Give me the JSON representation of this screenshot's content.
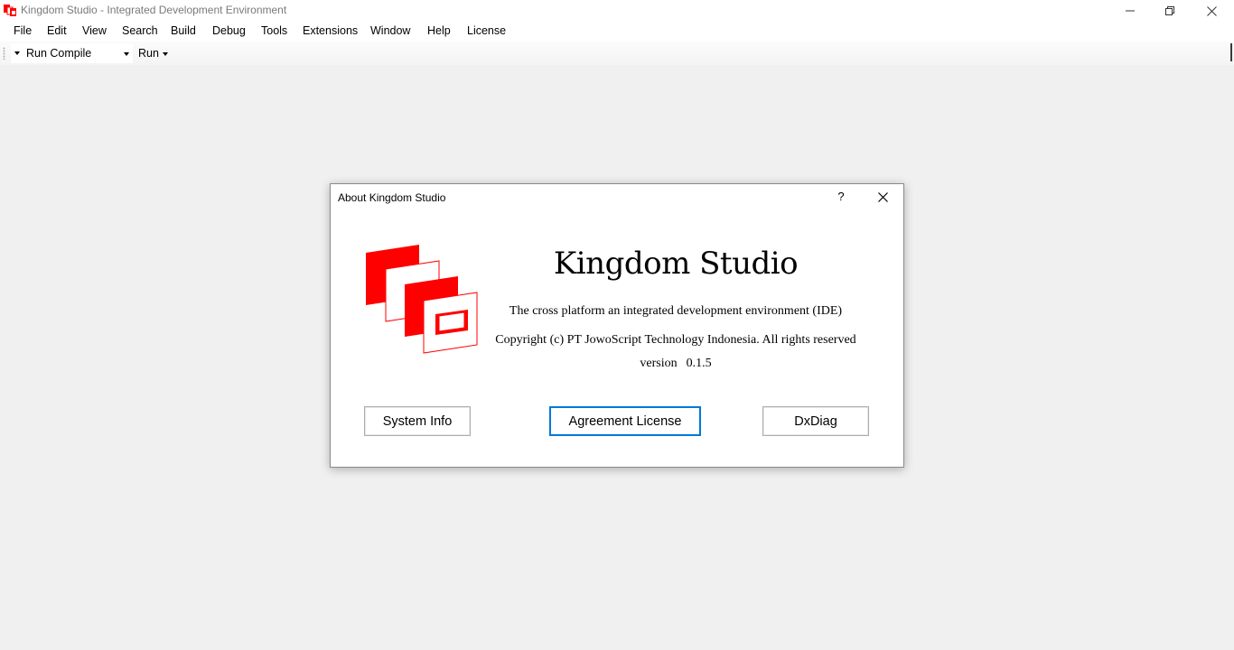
{
  "window": {
    "title": "Kingdom Studio - Integrated Development Environment",
    "icon": "kingdom-studio-logo-icon"
  },
  "menubar": {
    "items": [
      "File",
      "Edit",
      "View",
      "Search",
      "Build",
      "Debug",
      "Tools",
      "Extensions",
      "Window",
      "Help",
      "License"
    ]
  },
  "toolbar": {
    "build_config": "Run Compile",
    "run_label": "Run"
  },
  "about_dialog": {
    "title": "About Kingdom Studio",
    "help_label": "?",
    "product_name": "Kingdom Studio",
    "tagline": "The cross platform an integrated development environment (IDE)",
    "copyright": "Copyright (c) PT JowoScript Technology Indonesia. All rights reserved",
    "version_label": "version",
    "version_value": "0.1.5",
    "buttons": {
      "system_info": "System Info",
      "agreement_license": "Agreement License",
      "dxdiag": "DxDiag"
    }
  },
  "colors": {
    "brand_red": "#ff0000",
    "focus_blue": "#0078d7",
    "background": "#f0f0f0"
  }
}
